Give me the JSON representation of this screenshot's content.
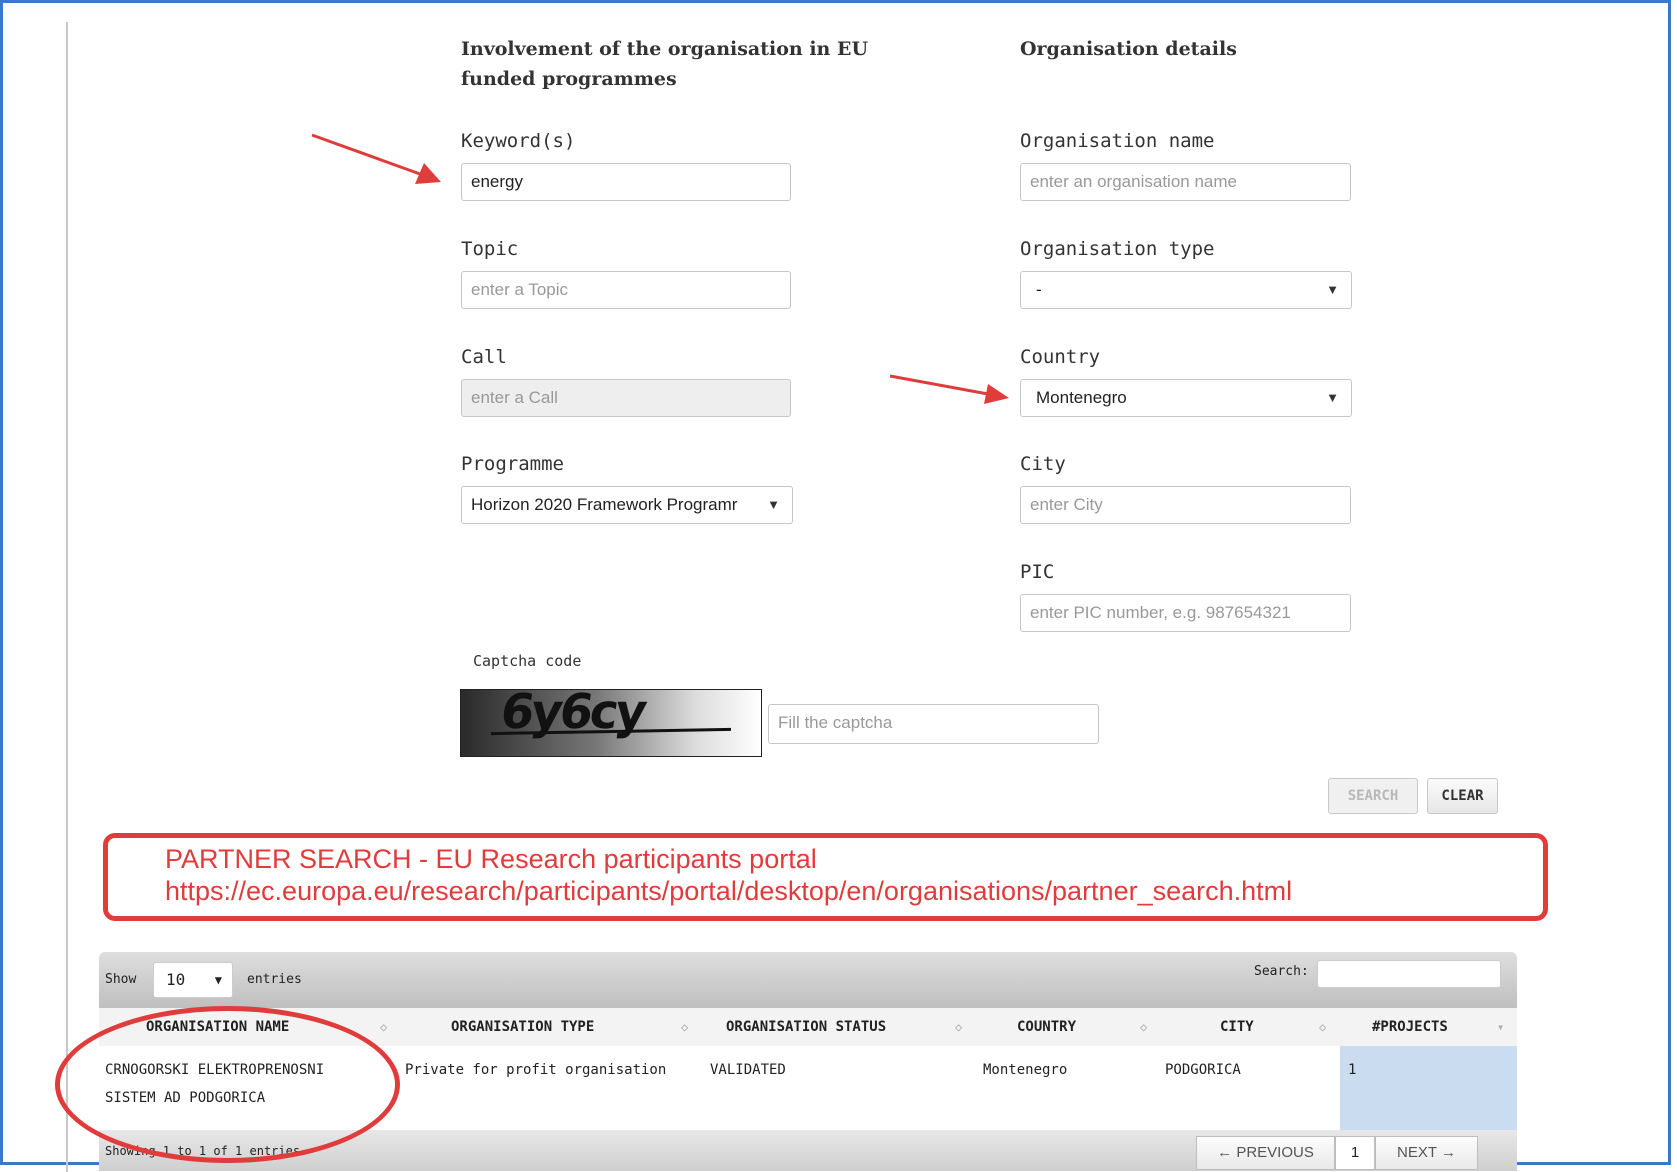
{
  "left_column": {
    "heading": "Involvement of the organisation in EU funded programmes",
    "keyword": {
      "label": "Keyword(s)",
      "value": "energy"
    },
    "topic": {
      "label": "Topic",
      "placeholder": "enter a Topic"
    },
    "call": {
      "label": "Call",
      "placeholder": "enter a Call"
    },
    "programme": {
      "label": "Programme",
      "value": "Horizon 2020 Framework Programr"
    }
  },
  "right_column": {
    "heading": "Organisation details",
    "org_name": {
      "label": "Organisation name",
      "placeholder": "enter an organisation name"
    },
    "org_type": {
      "label": "Organisation type",
      "value": "-"
    },
    "country": {
      "label": "Country",
      "value": "Montenegro"
    },
    "city": {
      "label": "City",
      "placeholder": "enter City"
    },
    "pic": {
      "label": "PIC",
      "placeholder": "enter PIC number, e.g. 987654321"
    }
  },
  "captcha": {
    "label": "Captcha code",
    "image_text": "6y6cy",
    "placeholder": "Fill the captcha"
  },
  "buttons": {
    "search": "SEARCH",
    "clear": "CLEAR"
  },
  "callout": {
    "line1": "PARTNER SEARCH - EU Research participants portal",
    "line2": "https://ec.europa.eu/research/participants/portal/desktop/en/organisations/partner_search.html"
  },
  "table": {
    "show_label": "Show",
    "page_length": "10",
    "entries_label": "entries",
    "search_label": "Search:",
    "columns": [
      "ORGANISATION NAME",
      "ORGANISATION TYPE",
      "ORGANISATION STATUS",
      "COUNTRY",
      "CITY",
      "#PROJECTS"
    ],
    "rows": [
      {
        "name_line1": "CRNOGORSKI ELEKTROPRENOSNI",
        "name_line2": "SISTEM AD PODGORICA",
        "type": "Private for profit organisation",
        "status": "VALIDATED",
        "country": "Montenegro",
        "city": "PODGORICA",
        "projects": "1"
      }
    ],
    "info": "Showing 1 to 1 of 1 entries.",
    "pager": {
      "prev": "← PREVIOUS",
      "current": "1",
      "next": "NEXT →"
    }
  },
  "colors": {
    "accent_red": "#e03c3c",
    "frame_blue": "#3b78c9",
    "highlight_cell": "#c9dcf0"
  },
  "icons": [
    "dropdown-caret-icon",
    "sort-icon",
    "annotation-arrow"
  ]
}
